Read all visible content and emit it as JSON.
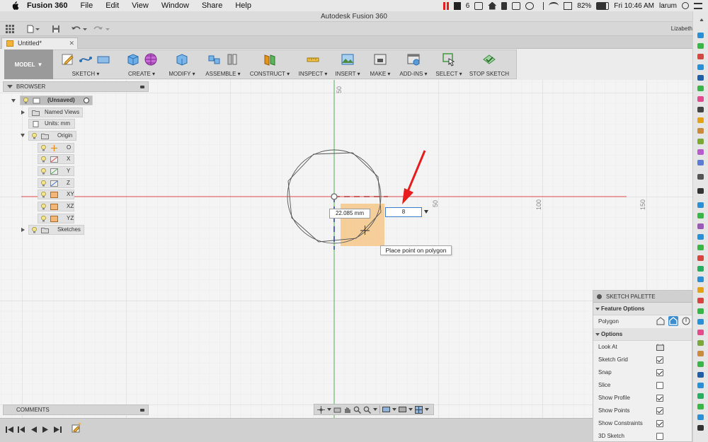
{
  "menubar": {
    "app_name": "Fusion 360",
    "items": [
      "File",
      "Edit",
      "View",
      "Window",
      "Share",
      "Help"
    ],
    "status": {
      "notification_count": "6",
      "battery": "82%",
      "clock": "Fri 10:46 AM",
      "user": "larum"
    }
  },
  "window": {
    "title": "Autodesk Fusion 360"
  },
  "qat": {
    "user_name": "Lizabeth"
  },
  "document": {
    "tab_label": "Untitled*"
  },
  "ribbon": {
    "mode_label": "MODEL",
    "groups": [
      "SKETCH",
      "CREATE",
      "MODIFY",
      "ASSEMBLE",
      "CONSTRUCT",
      "INSPECT",
      "INSERT",
      "MAKE",
      "ADD-INS",
      "SELECT",
      "STOP SKETCH"
    ]
  },
  "browser": {
    "title": "BROWSER",
    "root": "(Unsaved)",
    "named_views": "Named Views",
    "units": "Units: mm",
    "origin": "Origin",
    "origin_items": [
      "O",
      "X",
      "Y",
      "Z",
      "XY",
      "XZ",
      "YZ"
    ],
    "sketches": "Sketches"
  },
  "comments": {
    "title": "COMMENTS"
  },
  "canvas": {
    "axis_labels": {
      "v50": "50",
      "h50": "50",
      "h100": "100",
      "h150": "150"
    },
    "radius_dimension": "22.085 mm",
    "sides_value": "8",
    "tooltip": "Place point on polygon"
  },
  "palette": {
    "title": "SKETCH PALETTE",
    "feature_options": "Feature Options",
    "polygon_label": "Polygon",
    "options_label": "Options",
    "options": [
      {
        "label": "Look At",
        "checked": null
      },
      {
        "label": "Sketch Grid",
        "checked": true
      },
      {
        "label": "Snap",
        "checked": true
      },
      {
        "label": "Slice",
        "checked": false
      },
      {
        "label": "Show Profile",
        "checked": true
      },
      {
        "label": "Show Points",
        "checked": true
      },
      {
        "label": "Show Constraints",
        "checked": true
      },
      {
        "label": "3D Sketch",
        "checked": false
      }
    ]
  },
  "colors": {
    "x_axis": "#e04a4a",
    "y_axis": "#4caf50",
    "selection_fill": "#f5c78a",
    "arrow": "#e81c1c",
    "accent_blue": "#3a7fcf"
  }
}
